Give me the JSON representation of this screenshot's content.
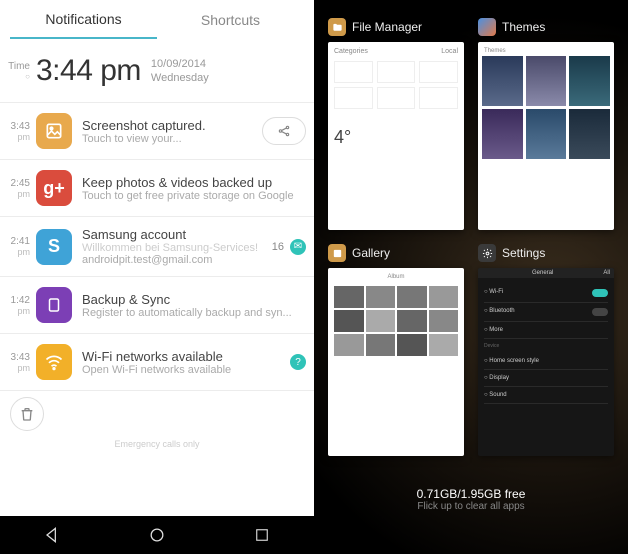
{
  "left": {
    "tabs": {
      "notifications": "Notifications",
      "shortcuts": "Shortcuts"
    },
    "time_col_header": "Time",
    "clock": {
      "time": "3:44 pm",
      "date": "10/09/2014",
      "day": "Wednesday"
    },
    "notifications": [
      {
        "ts": "3:43",
        "ts2": "pm",
        "title": "Screenshot captured.",
        "sub": "Touch to view your...",
        "icon_bg": "#e8a94d",
        "icon_txt": "",
        "share": true
      },
      {
        "ts": "2:45",
        "ts2": "pm",
        "title": "Keep photos & videos backed up",
        "sub": "Touch to get free private storage on Google",
        "icon_bg": "#da4c3d",
        "icon_txt": "g+"
      },
      {
        "ts": "2:41",
        "ts2": "pm",
        "title": "Samsung account",
        "sub": "androidpit.test@gmail.com",
        "sub_pre": "Willkommen bei Samsung-Services!",
        "icon_bg": "#3fa3d7",
        "icon_txt": "S",
        "count": "16",
        "dot_bg": "#2fc3b8"
      },
      {
        "ts": "1:42",
        "ts2": "pm",
        "title": "Backup & Sync",
        "sub": "Register to automatically backup and syn...",
        "icon_bg": "#7c3fb5",
        "icon_txt": "❑"
      },
      {
        "ts": "3:43",
        "ts2": "pm",
        "title": "Wi-Fi networks available",
        "sub": "Open Wi-Fi networks available",
        "icon_bg": "#f2b029",
        "icon_txt": "",
        "wifi": true,
        "trail_dot": "#2fc3b8",
        "trail_txt": "?"
      }
    ],
    "emergency": "Emergency calls only"
  },
  "right": {
    "cards": [
      {
        "title": "File Manager",
        "icon_bg": "#cf9a4a"
      },
      {
        "title": "Themes",
        "icon_bg": "linear-gradient(135deg,#4a90e2,#e27a4a)"
      },
      {
        "title": "Gallery",
        "icon_bg": "#cf9a4a"
      },
      {
        "title": "Settings",
        "icon_bg": "#3a3a3a"
      }
    ],
    "mem": {
      "used": "0.71GB",
      "sep": "/",
      "total": "1.95GB",
      "suffix": " free"
    },
    "hint": "Flick up to clear all apps"
  }
}
